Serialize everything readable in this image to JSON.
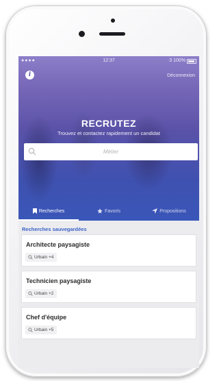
{
  "status_bar": {
    "signal": "●●●● ",
    "time": "12:37",
    "battery_text": "3 100%"
  },
  "header": {
    "logout_label": "Déconnexion",
    "info_icon": "info-icon"
  },
  "hero": {
    "title": "RECRUTEZ",
    "subtitle": "Trouvez et contactez rapidement un candidat"
  },
  "search": {
    "placeholder": "Métier",
    "value": ""
  },
  "tabs": [
    {
      "label": "Recherches",
      "icon": "bookmark-icon",
      "active": true
    },
    {
      "label": "Favoris",
      "icon": "star-icon",
      "active": false
    },
    {
      "label": "Propositions",
      "icon": "paper-plane-icon",
      "active": false
    }
  ],
  "saved_searches": {
    "title": "Recherches sauvegardées",
    "items": [
      {
        "title": "Architecte paysagiste",
        "tag": "Urbain +4"
      },
      {
        "title": "Technicien paysagiste",
        "tag": "Urbain +2"
      },
      {
        "title": "Chef d'équipe",
        "tag": "Urbain +5"
      }
    ]
  },
  "colors": {
    "accent": "#3b62c8",
    "hero_top": "#8d7ec9",
    "hero_bottom": "#3a56b8"
  }
}
